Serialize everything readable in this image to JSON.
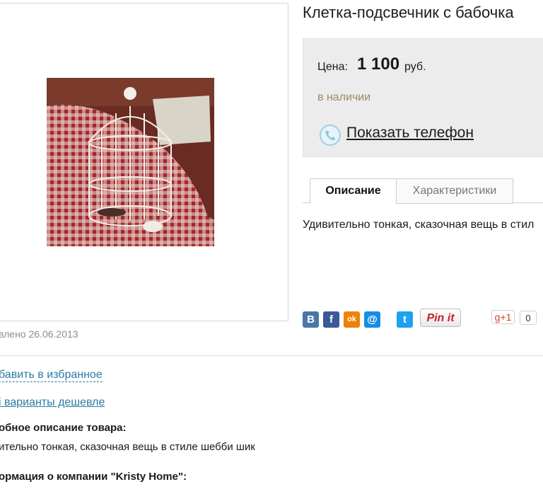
{
  "product": {
    "title": "Клетка-подсвечник с бабочка",
    "image_alt": "белая клетка-подсвечник на клетчатой ткани"
  },
  "price": {
    "label": "Цена:",
    "value": "1 100",
    "unit": "руб.",
    "availability": "в наличии",
    "show_phone": "Показать телефон"
  },
  "tabs": [
    {
      "label": "Описание",
      "active": true
    },
    {
      "label": "Характеристики",
      "active": false
    }
  ],
  "description_short": "Удивительно тонкая, сказочная вещь в стил",
  "share": {
    "vk": "В",
    "fb": "f",
    "ok": "ok",
    "mail": "@",
    "twitter": "t",
    "pin": "Pin it",
    "gplus": "g+1",
    "gplus_count": "0"
  },
  "updated": "влено 26.06.2013",
  "links": {
    "favorite": "бавить в избранное",
    "cheaper": "і варианты дешевле"
  },
  "details": {
    "description_heading": "обное описание товара:",
    "description_text": "ительно тонкая, сказочная вещь в стиле шебби шик",
    "company_heading": "ормация о компании \"Kristy Home\":"
  },
  "colors": {
    "link": "#2a7aa5",
    "stock": "#9a8b63",
    "price_box": "#ececec",
    "vk": "#4a76a8",
    "fb": "#3b5998",
    "ok": "#ee8208",
    "mail": "#168de2",
    "twitter": "#1da1f2"
  }
}
